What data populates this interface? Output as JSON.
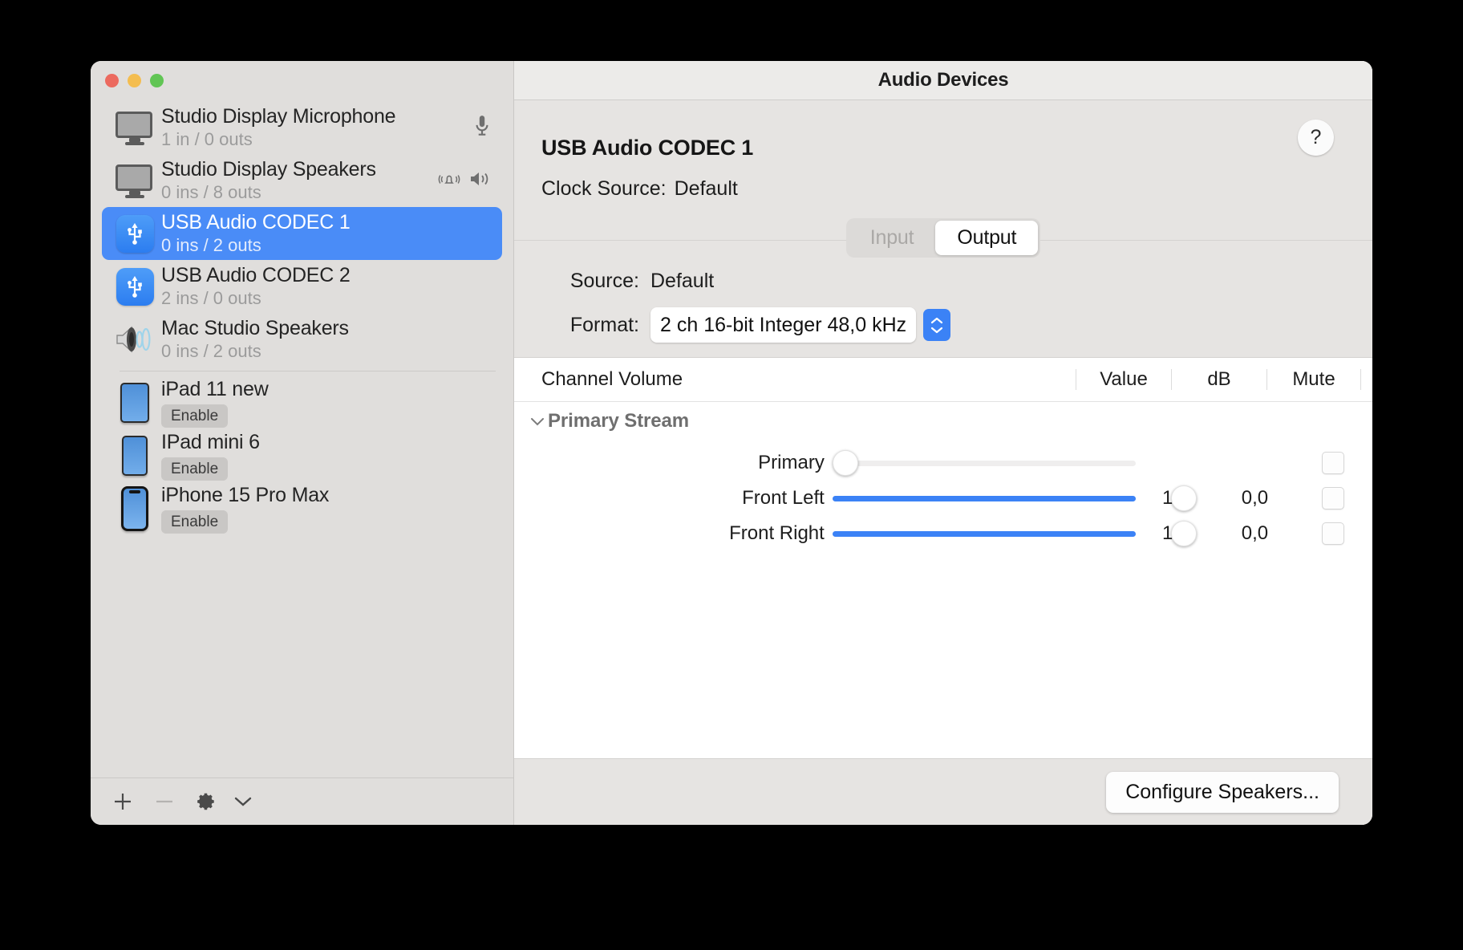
{
  "window": {
    "title": "Audio Devices",
    "traffic_lights": [
      "close",
      "minimize",
      "zoom"
    ]
  },
  "sidebar": {
    "devices": [
      {
        "name": "Studio Display Microphone",
        "sub": "1 in / 0 outs",
        "icon": "display-icon",
        "selected": false,
        "badges": [
          "microphone-icon"
        ]
      },
      {
        "name": "Studio Display Speakers",
        "sub": "0 ins / 8 outs",
        "icon": "display-icon",
        "selected": false,
        "badges": [
          "alert-bell-icon",
          "speaker-icon"
        ]
      },
      {
        "name": "USB Audio CODEC  1",
        "sub": "0 ins / 2 outs",
        "icon": "usb-icon",
        "selected": true,
        "badges": []
      },
      {
        "name": "USB Audio CODEC  2",
        "sub": "2 ins / 0 outs",
        "icon": "usb-icon",
        "selected": false,
        "badges": []
      },
      {
        "name": "Mac Studio Speakers",
        "sub": "0 ins / 2 outs",
        "icon": "speaker-waves-icon",
        "selected": false,
        "badges": []
      }
    ],
    "remote_devices": [
      {
        "name": "iPad 11 new",
        "action": "Enable",
        "icon": "ipad-icon"
      },
      {
        "name": "IPad mini 6",
        "action": "Enable",
        "icon": "ipad-icon"
      },
      {
        "name": "iPhone 15 Pro Max",
        "action": "Enable",
        "icon": "iphone-icon"
      }
    ],
    "toolbar": {
      "add_label": "+",
      "remove_label": "−",
      "gear_label": "gear-icon",
      "chevron_label": "chevron-down-icon"
    }
  },
  "detail": {
    "device_title": "USB Audio CODEC  1",
    "clock_source_label": "Clock Source:",
    "clock_source_value": "Default",
    "help_label": "?",
    "tabs": [
      {
        "label": "Input",
        "active": false,
        "disabled": true
      },
      {
        "label": "Output",
        "active": true,
        "disabled": false
      }
    ],
    "source_label": "Source:",
    "source_value": "Default",
    "format_label": "Format:",
    "format_value": "2 ch 16-bit Integer 48,0 kHz",
    "table": {
      "headers": {
        "name": "Channel Volume",
        "value": "Value",
        "db": "dB",
        "mute": "Mute"
      },
      "group_label": "Primary Stream",
      "rows": [
        {
          "name": "Primary",
          "volume": 0.0,
          "value": "",
          "db": "",
          "muted": false,
          "show_fill": false
        },
        {
          "name": "Front Left",
          "volume": 1.0,
          "value": "1,0",
          "db": "0,0",
          "muted": false,
          "show_fill": true
        },
        {
          "name": "Front Right",
          "volume": 1.0,
          "value": "1,0",
          "db": "0,0",
          "muted": false,
          "show_fill": true
        }
      ]
    },
    "configure_button": "Configure Speakers..."
  },
  "colors": {
    "accent": "#3b82f6",
    "selection": "#4a8cf7",
    "window_bg": "#e6e4e2",
    "sidebar_bg": "#e0dedc"
  }
}
